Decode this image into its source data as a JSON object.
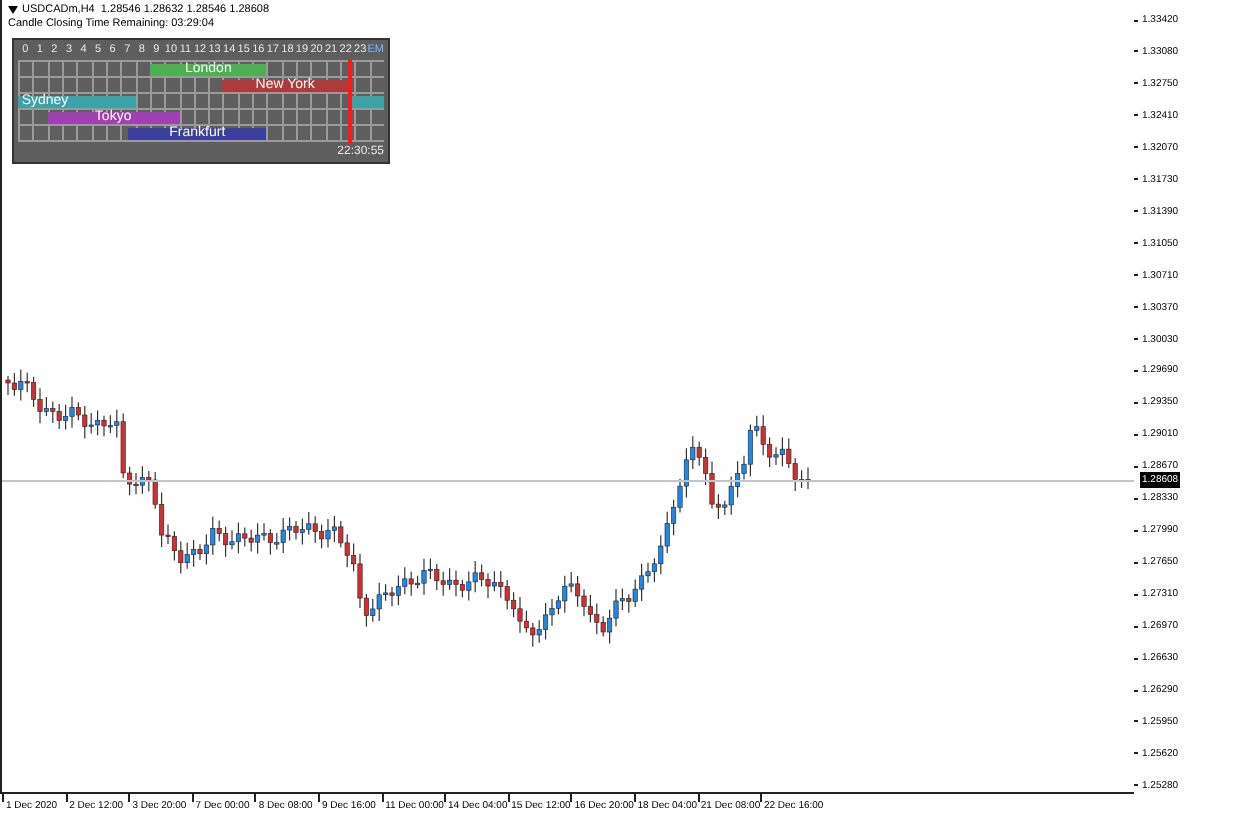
{
  "chart_header": {
    "symbol_line": "USDCADm,H4  1.28546 1.28632 1.28546 1.28608",
    "countdown": "Candle Closing Time Remaining: 03:29:04"
  },
  "sessions_panel": {
    "hours": [
      "0",
      "1",
      "2",
      "3",
      "4",
      "5",
      "6",
      "7",
      "8",
      "9",
      "10",
      "11",
      "12",
      "13",
      "14",
      "15",
      "16",
      "17",
      "18",
      "19",
      "20",
      "21",
      "22",
      "23",
      "EM"
    ],
    "sessions": [
      {
        "name": "London",
        "color": "#4caf50"
      },
      {
        "name": "New York",
        "color": "#b03a3a"
      },
      {
        "name": "Sydney",
        "color": "#3aa3a8"
      },
      {
        "name": "Tokyo",
        "color": "#a23fb5"
      },
      {
        "name": "Frankfurt",
        "color": "#3b3f9e"
      }
    ],
    "clock": "22:30:55"
  },
  "price_axis": {
    "labels": [
      "1.33420",
      "1.33080",
      "1.32750",
      "1.32410",
      "1.32070",
      "1.31730",
      "1.31390",
      "1.31050",
      "1.30710",
      "1.30370",
      "1.30030",
      "1.29690",
      "1.29350",
      "1.29010",
      "1.28670",
      "1.28330",
      "1.27990",
      "1.27650",
      "1.27310",
      "1.26970",
      "1.26630",
      "1.26290",
      "1.25950",
      "1.25620",
      "1.25280"
    ],
    "current_price": "1.28608"
  },
  "time_axis": {
    "labels": [
      "1 Dec 2020",
      "2 Dec 12:00",
      "3 Dec 20:00",
      "7 Dec 00:00",
      "8 Dec 08:00",
      "9 Dec 16:00",
      "11 Dec 00:00",
      "14 Dec 04:00",
      "15 Dec 12:00",
      "16 Dec 20:00",
      "18 Dec 04:00",
      "21 Dec 08:00",
      "22 Dec 16:00"
    ]
  }
}
